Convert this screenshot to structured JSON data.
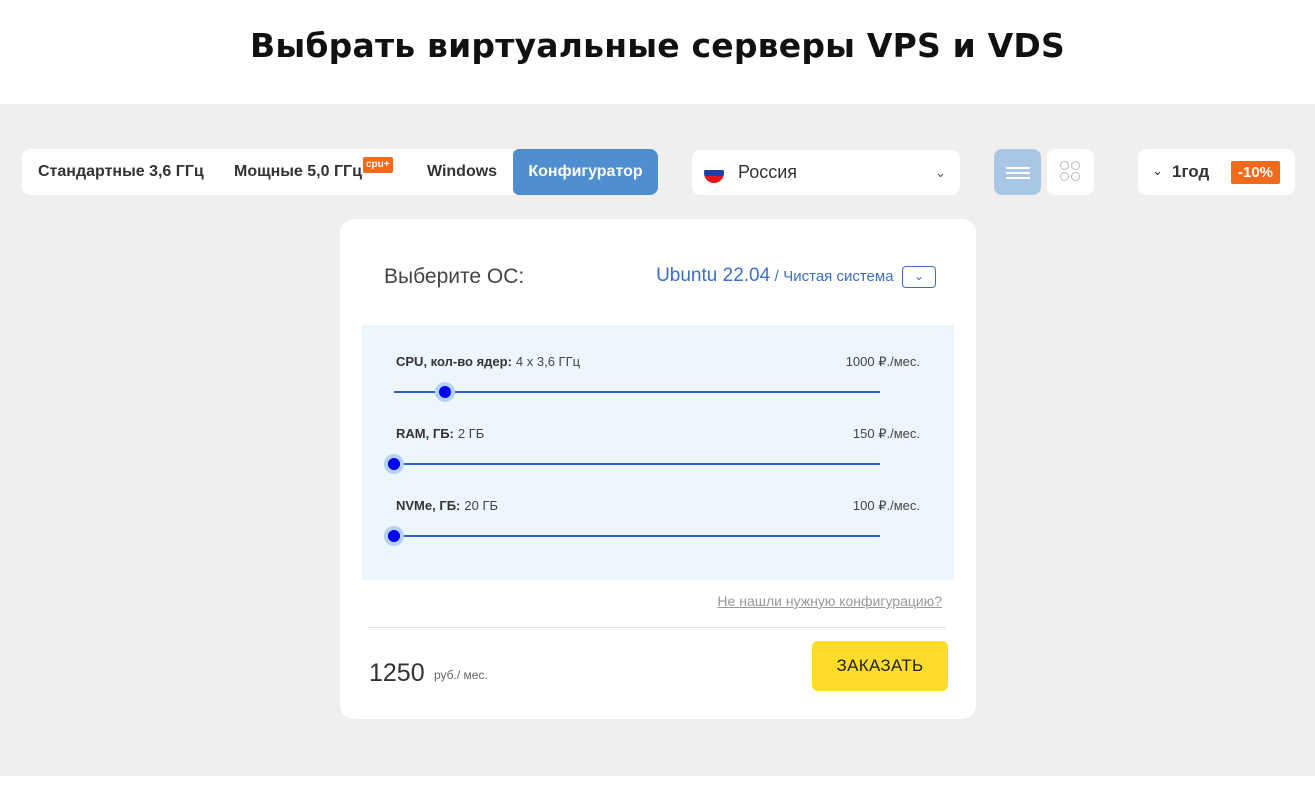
{
  "page": {
    "title": "Выбрать виртуальные серверы VPS и VDS"
  },
  "tabs": {
    "items": [
      {
        "label": "Стандартные 3,6 ГГц"
      },
      {
        "label": "Мощные 5,0 ГГц",
        "badge": "cpu+"
      },
      {
        "label": "Windows"
      },
      {
        "label": "Конфигуратор",
        "active": true
      }
    ]
  },
  "country": {
    "label": "Россия",
    "flag_colors": [
      "#ffffff",
      "#1c3faa",
      "#e4181c"
    ]
  },
  "view": {
    "list_icon": "list-icon",
    "grid_icon": "grid-icon",
    "active": "list"
  },
  "period": {
    "label": "1год",
    "discount": "-10%"
  },
  "os": {
    "label": "Выберите ОС:",
    "selected": "Ubuntu 22.04",
    "separator": "/",
    "variant": "Чистая система"
  },
  "config": {
    "rows": [
      {
        "label": "CPU, кол-во ядер:",
        "value": "4 x 3,6 ГГц",
        "price": "1000 ₽./мес.",
        "level": 0.105
      },
      {
        "label": "RAM, ГБ:",
        "value": "2 ГБ",
        "price": "150 ₽./мес.",
        "level": 0
      },
      {
        "label": "NVMe, ГБ:",
        "value": "20 ГБ",
        "price": "100 ₽./мес.",
        "level": 0
      }
    ],
    "help_link": "Не нашли нужную конфигурацию?"
  },
  "summary": {
    "total": "1250",
    "unit": "руб./ мес.",
    "order_label": "ЗАКАЗАТЬ"
  },
  "colors": {
    "accent": "#4f8fd0",
    "badge": "#f26a1b",
    "order": "#fddd2a",
    "link": "#3a6fc4"
  }
}
